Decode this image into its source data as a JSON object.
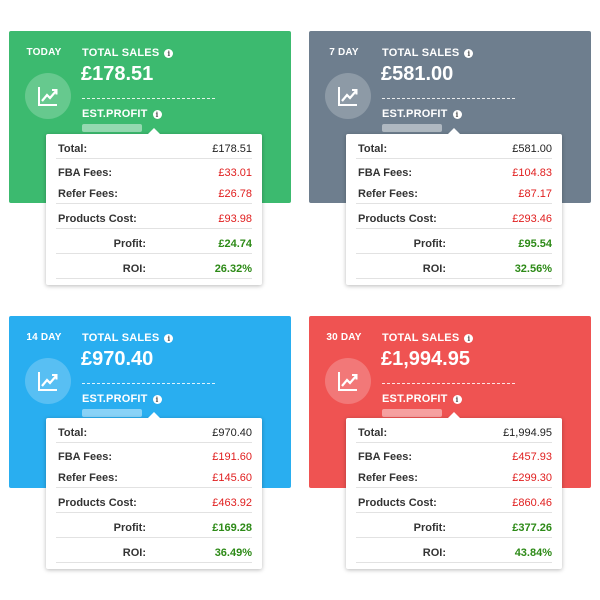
{
  "labels": {
    "total_sales": "TOTAL SALES",
    "est_profit": "EST.PROFIT",
    "info_glyph": "i",
    "total": "Total:",
    "fba_fees": "FBA Fees:",
    "refer_fees": "Refer Fees:",
    "products_cost": "Products Cost:",
    "profit": "Profit:",
    "roi": "ROI:"
  },
  "colors": {
    "today": "#3cba6f",
    "7day": "#6e7e8e",
    "14day": "#29aef0",
    "30day": "#ef5352",
    "fee_red": "#e01e1e",
    "profit_green": "#2d8a17"
  },
  "icons": {
    "badge": "chart-trend-icon",
    "info": "info-icon"
  },
  "cards": [
    {
      "period": "TODAY",
      "total_sales": "£178.51",
      "total": "£178.51",
      "fba_fees": "£33.01",
      "refer_fees": "£26.78",
      "products_cost": "£93.98",
      "profit": "£24.74",
      "roi": "26.32%"
    },
    {
      "period": "7 DAY",
      "total_sales": "£581.00",
      "total": "£581.00",
      "fba_fees": "£104.83",
      "refer_fees": "£87.17",
      "products_cost": "£293.46",
      "profit": "£95.54",
      "roi": "32.56%"
    },
    {
      "period": "14 DAY",
      "total_sales": "£970.40",
      "total": "£970.40",
      "fba_fees": "£191.60",
      "refer_fees": "£145.60",
      "products_cost": "£463.92",
      "profit": "£169.28",
      "roi": "36.49%"
    },
    {
      "period": "30 DAY",
      "total_sales": "£1,994.95",
      "total": "£1,994.95",
      "fba_fees": "£457.93",
      "refer_fees": "£299.30",
      "products_cost": "£860.46",
      "profit": "£377.26",
      "roi": "43.84%"
    }
  ]
}
